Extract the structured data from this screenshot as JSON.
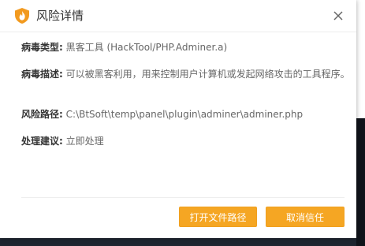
{
  "dialog": {
    "title": "风险详情",
    "icon": "flame-shield-icon",
    "accent_color": "#f5a623"
  },
  "details": {
    "virus_type_label": "病毒类型:",
    "virus_type_value": "黑客工具 (HackTool/PHP.Adminer.a)",
    "virus_desc_label": "病毒描述:",
    "virus_desc_value": "可以被黑客利用，用来控制用户计算机或发起网络攻击的工具程序。",
    "risk_path_label": "风险路径:",
    "risk_path_value": "C:\\BtSoft\\temp\\panel\\plugin\\adminer\\adminer.php",
    "suggestion_label": "处理建议:",
    "suggestion_value": "立即处理"
  },
  "buttons": {
    "open_path_label": "打开文件路径",
    "cancel_trust_label": "取消信任"
  }
}
